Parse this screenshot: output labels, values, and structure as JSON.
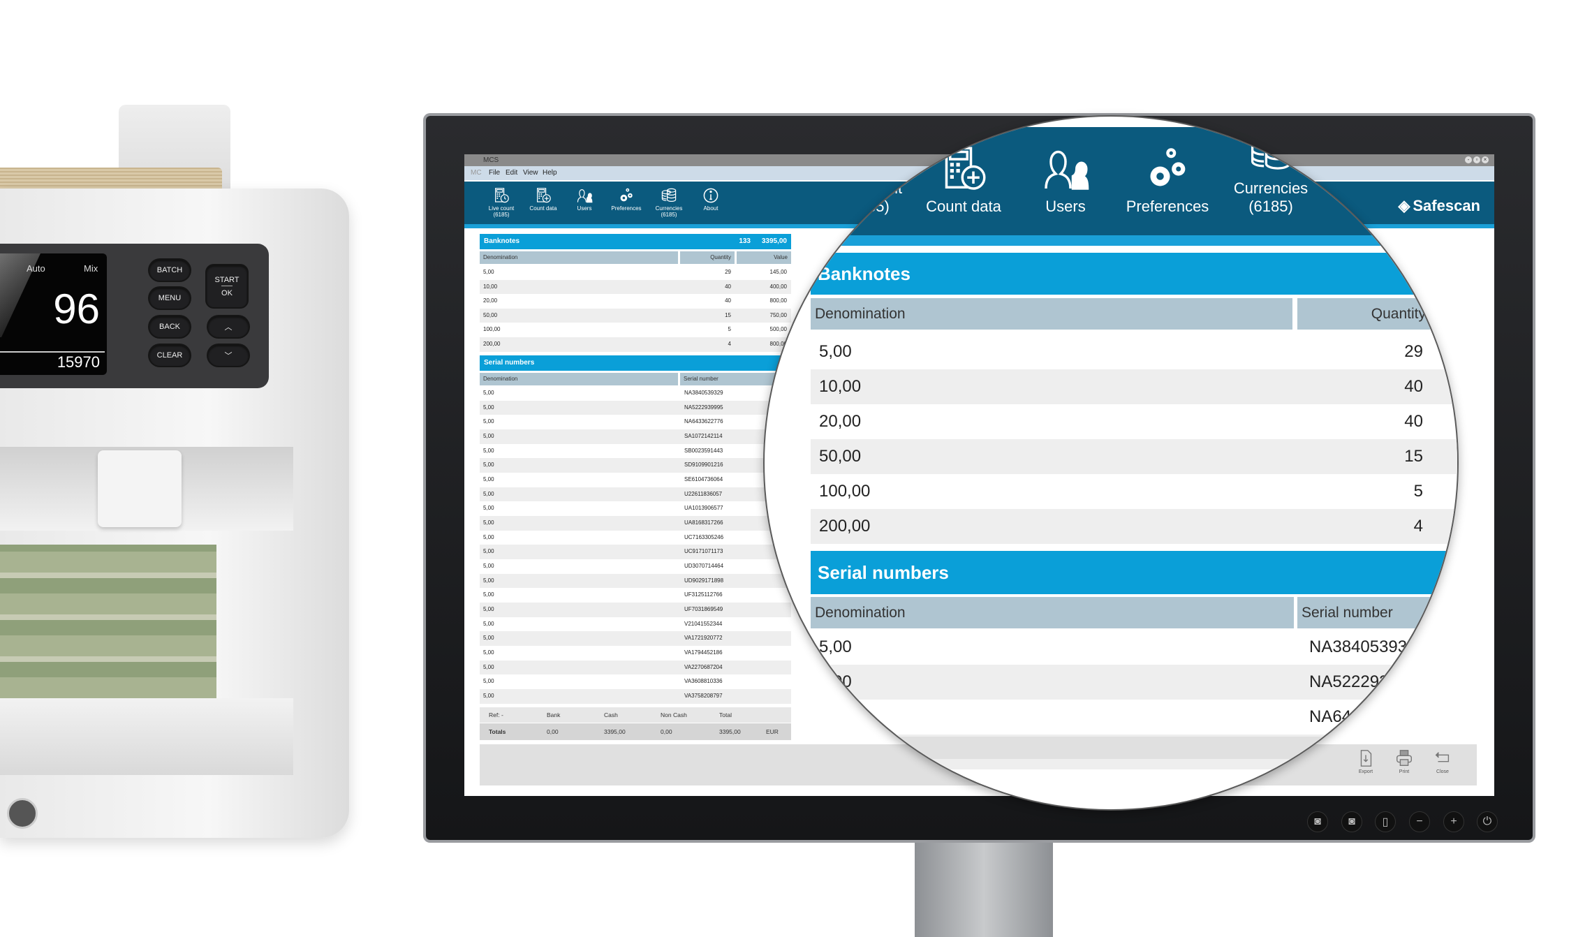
{
  "machine": {
    "mode_left": "Auto",
    "mode_right": "Mix",
    "count": "96",
    "total": "15970",
    "buttons": {
      "batch": "BATCH",
      "menu": "MENU",
      "back": "BACK",
      "clear": "CLEAR",
      "start": "START",
      "ok": "OK"
    }
  },
  "window": {
    "title": "MCS"
  },
  "menu": [
    "MC",
    "File",
    "Edit",
    "View",
    "Help"
  ],
  "toolbar": [
    {
      "icon": "live-count-icon",
      "label": "Live count",
      "sub": "(6185)"
    },
    {
      "icon": "count-data-icon",
      "label": "Count data",
      "sub": ""
    },
    {
      "icon": "users-icon",
      "label": "Users",
      "sub": ""
    },
    {
      "icon": "preferences-icon",
      "label": "Preferences",
      "sub": ""
    },
    {
      "icon": "currencies-icon",
      "label": "Currencies",
      "sub": "(6185)"
    },
    {
      "icon": "about-icon",
      "label": "About",
      "sub": ""
    }
  ],
  "brand": "Safescan",
  "banknotes": {
    "title": "Banknotes",
    "quantity_total": "133",
    "value_total": "3395,00",
    "columns": [
      "Denomination",
      "Quantity",
      "Value"
    ],
    "rows": [
      [
        "5,00",
        "29",
        "145,00"
      ],
      [
        "10,00",
        "40",
        "400,00"
      ],
      [
        "20,00",
        "40",
        "800,00"
      ],
      [
        "50,00",
        "15",
        "750,00"
      ],
      [
        "100,00",
        "5",
        "500,00"
      ],
      [
        "200,00",
        "4",
        "800,00"
      ]
    ]
  },
  "serials": {
    "title": "Serial numbers",
    "columns": [
      "Denomination",
      "Serial number"
    ],
    "rows": [
      [
        "5,00",
        "NA3840539329"
      ],
      [
        "5,00",
        "NA5222939995"
      ],
      [
        "5,00",
        "NA6433622776"
      ],
      [
        "5,00",
        "SA1072142114"
      ],
      [
        "5,00",
        "SB0023591443"
      ],
      [
        "5,00",
        "SD9109901216"
      ],
      [
        "5,00",
        "SE6104736064"
      ],
      [
        "5,00",
        "U22611836057"
      ],
      [
        "5,00",
        "UA1013906577"
      ],
      [
        "5,00",
        "UA8168317266"
      ],
      [
        "5,00",
        "UC7163305246"
      ],
      [
        "5,00",
        "UC9171071173"
      ],
      [
        "5,00",
        "UD3070714464"
      ],
      [
        "5,00",
        "UD9029171898"
      ],
      [
        "5,00",
        "UF3125112766"
      ],
      [
        "5,00",
        "UF7031869549"
      ],
      [
        "5,00",
        "V21041552344"
      ],
      [
        "5,00",
        "VA1721920772"
      ],
      [
        "5,00",
        "VA1794452186"
      ],
      [
        "5,00",
        "VA2270687204"
      ],
      [
        "5,00",
        "VA3608810336"
      ],
      [
        "5,00",
        "VA3758208797"
      ]
    ]
  },
  "totals": {
    "ref_label": "Ref: -",
    "headers": [
      "Bank",
      "Cash",
      "Non Cash",
      "Total"
    ],
    "row_label": "Totals",
    "values": [
      "0,00",
      "3395,00",
      "0,00",
      "3395,00"
    ],
    "currency": "EUR"
  },
  "actions": [
    {
      "icon": "export-icon",
      "label": "Export"
    },
    {
      "icon": "print-icon",
      "label": "Print"
    },
    {
      "icon": "close-icon",
      "label": "Close"
    }
  ],
  "colors": {
    "toolbar": "#0b5a7e",
    "accent": "#0a9fd8",
    "column_header": "#afc5d1"
  }
}
